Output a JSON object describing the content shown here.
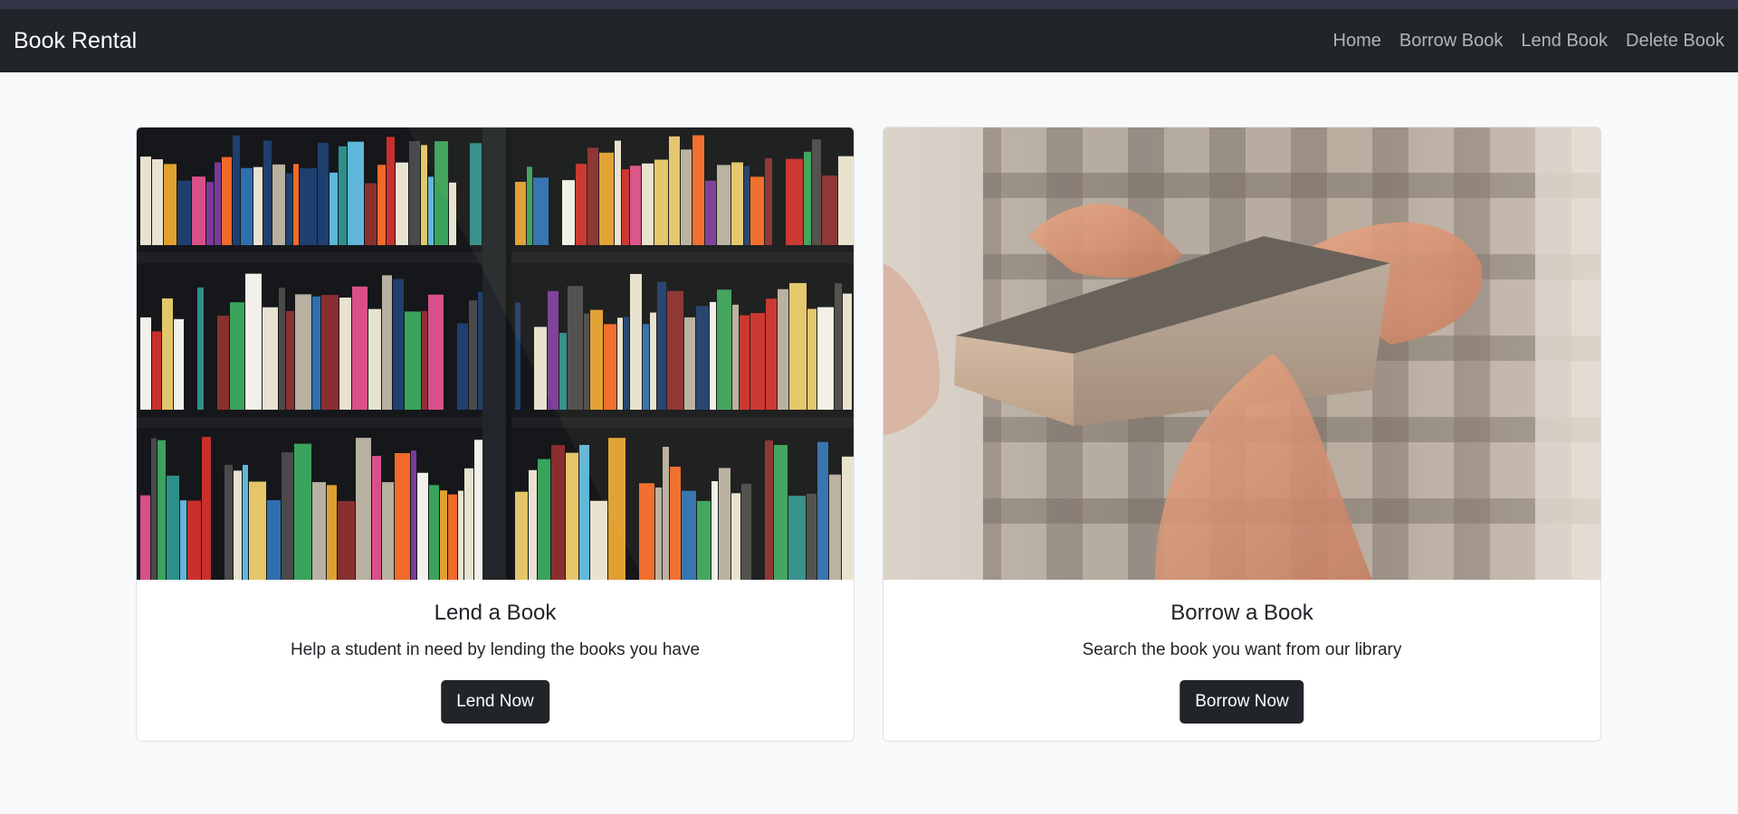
{
  "navbar": {
    "brand": "Book Rental",
    "links": [
      "Home",
      "Borrow Book",
      "Lend Book",
      "Delete Book"
    ]
  },
  "cards": [
    {
      "title": "Lend a Book",
      "text": "Help a student in need by lending the books you have",
      "button": "Lend Now",
      "image": "bookshelf-photo"
    },
    {
      "title": "Borrow a Book",
      "text": "Search the book you want from our library",
      "button": "Borrow Now",
      "image": "book-handover-photo"
    }
  ],
  "colors": {
    "page_background": "#f8f9fa",
    "navbar": "#212529",
    "button": "#212529",
    "card_border": "#dfe2e5"
  }
}
